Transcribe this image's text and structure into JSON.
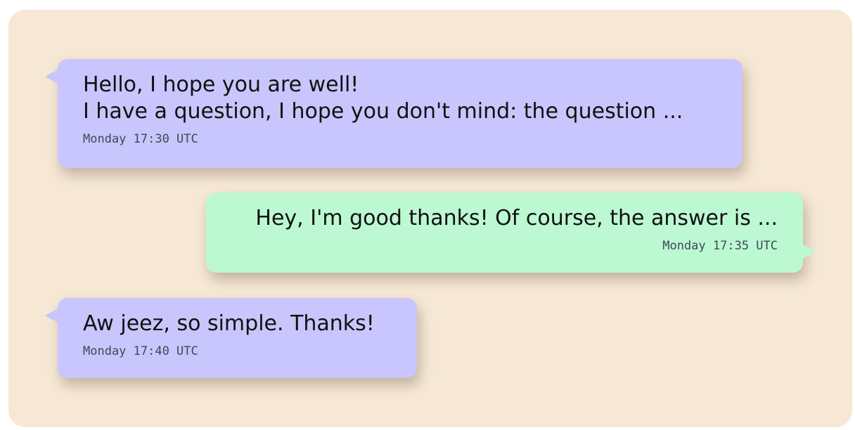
{
  "messages": [
    {
      "direction": "received",
      "lines": [
        "Hello, I hope you are well!",
        "I have a question, I hope you don't mind: the question ..."
      ],
      "timestamp": "Monday 17:30 UTC"
    },
    {
      "direction": "sent",
      "lines": [
        "Hey, I'm good thanks! Of course, the answer is ..."
      ],
      "timestamp": "Monday 17:35 UTC"
    },
    {
      "direction": "received",
      "lines": [
        "Aw jeez, so simple. Thanks!"
      ],
      "timestamp": "Monday 17:40 UTC"
    }
  ],
  "colors": {
    "panel_background": "#f7e8d6",
    "received_bubble": "#c8c6fc",
    "sent_bubble": "#bcf9d3",
    "timestamp_text": "#3d4a55"
  }
}
